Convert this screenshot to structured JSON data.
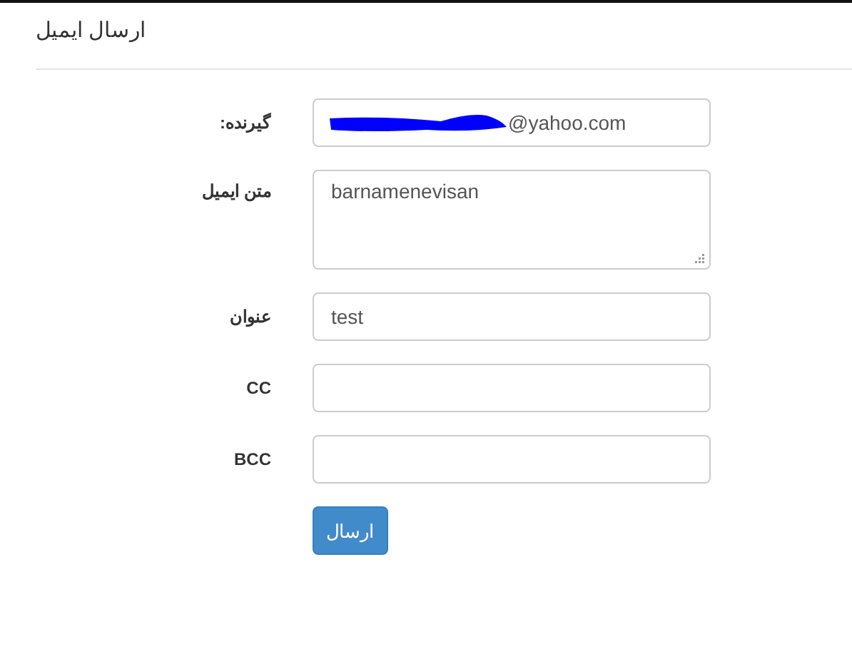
{
  "heading": "ارسال ایمیل",
  "fields": [
    {
      "label": "گیرنده:",
      "kind": "input",
      "value": "@yahoo.com",
      "redacted": true
    },
    {
      "label": "متن ایمیل",
      "kind": "textarea",
      "value": "barnamenevisan",
      "redacted": false
    },
    {
      "label": "عنوان",
      "kind": "input",
      "value": "test",
      "redacted": false
    },
    {
      "label": "CC",
      "kind": "input",
      "redacted": false
    },
    {
      "label": "BCC",
      "kind": "input",
      "redacted": false
    }
  ],
  "submit": "ارسال"
}
